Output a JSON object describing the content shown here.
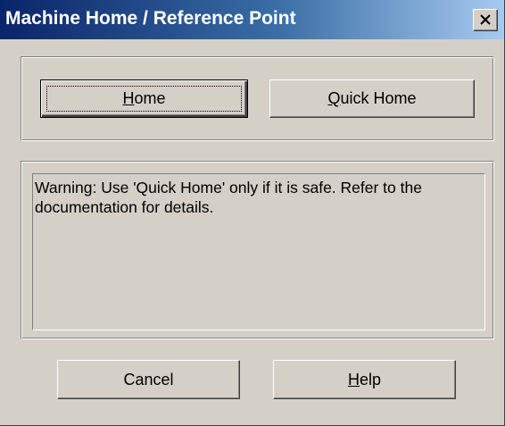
{
  "window": {
    "title": "Machine Home / Reference Point",
    "close_label": "close"
  },
  "buttons": {
    "home": {
      "mnemonic": "H",
      "rest": "ome"
    },
    "quick_home": {
      "mnemonic": "Q",
      "rest": "uick Home"
    },
    "cancel": "Cancel",
    "help": {
      "mnemonic": "H",
      "rest": "elp"
    }
  },
  "message": "Warning: Use 'Quick Home' only if it is safe.  Refer to the documentation for details.",
  "colors": {
    "titlebar_start": "#0a246a",
    "titlebar_end": "#a6caf0",
    "face": "#d4d0c8"
  }
}
